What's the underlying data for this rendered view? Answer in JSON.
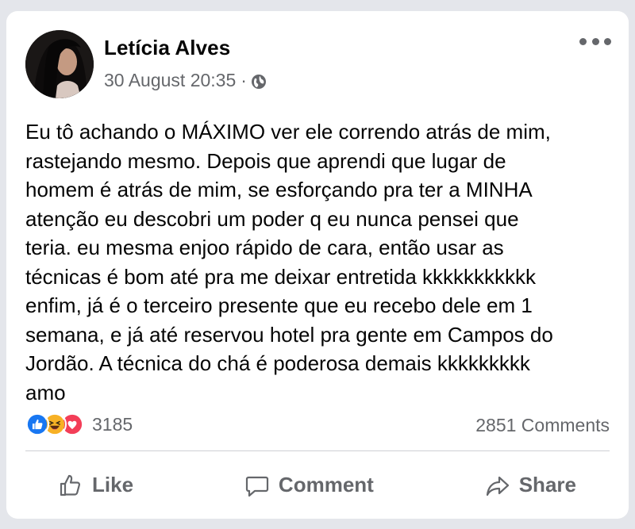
{
  "post": {
    "author": "Letícia Alves",
    "timestamp": "30 August 20:35",
    "separator": "·",
    "privacy_icon": "globe-icon",
    "text": "Eu tô achando o MÁXIMO ver ele correndo atrás de mim,\nrastejando mesmo. Depois que aprendi que lugar de\nhomem é atrás de mim, se esforçando pra ter a MINHA\natenção eu descobri um poder q eu nunca pensei que\nteria. eu mesma enjoo rápido de cara, então usar as\ntécnicas é bom até pra me deixar entretida kkkkkkkkkkk\nenfim, já é o terceiro presente que eu recebo dele em 1\nsemana, e já até reservou hotel pra gente em Campos do\nJordão. A técnica do chá é poderosa demais kkkkkkkkk\namo"
  },
  "stats": {
    "reactions": [
      "like-icon",
      "haha-icon",
      "love-icon"
    ],
    "reaction_count": "3185",
    "comments": "2851 Comments"
  },
  "actions": {
    "like": "Like",
    "comment": "Comment",
    "share": "Share"
  },
  "colors": {
    "like_blue": "#1877f2",
    "love_red": "#f33e58",
    "haha_yellow": "#f7b125",
    "secondary_text": "#65676b"
  }
}
